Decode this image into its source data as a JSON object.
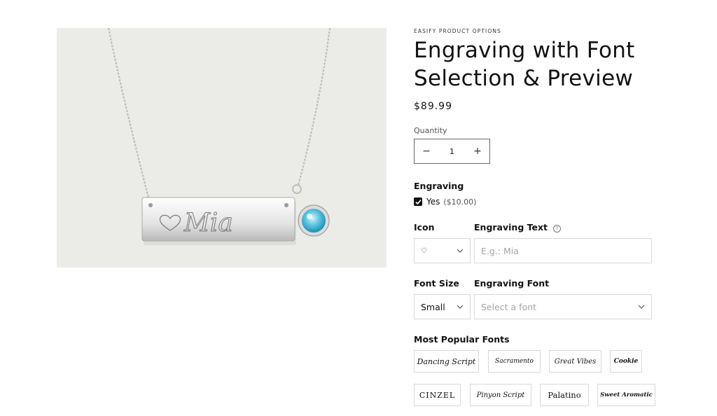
{
  "product": {
    "vendor": "EASIFY PRODUCT OPTIONS",
    "title": "Engraving with Font Selection & Preview",
    "price": "$89.99",
    "engraved_preview": "Mia"
  },
  "quantity": {
    "label": "Quantity",
    "minus": "−",
    "value": "1",
    "plus": "+"
  },
  "engraving": {
    "label": "Engraving",
    "checkbox_label": "Yes",
    "checkbox_price": "($10.00)",
    "checked": true
  },
  "icon": {
    "label": "Icon",
    "selected": "♡"
  },
  "engraving_text": {
    "label": "Engraving Text",
    "help": "?",
    "placeholder": "E.g.: Mia"
  },
  "font_size": {
    "label": "Font Size",
    "selected": "Small"
  },
  "engraving_font": {
    "label": "Engraving Font",
    "placeholder": "Select a font"
  },
  "popular_fonts": {
    "label": "Most Popular Fonts",
    "fonts": [
      "Dancing Script",
      "Sacramento",
      "Great Vibes",
      "Cookie",
      "Cinzel",
      "Pinyon Script",
      "Palatino",
      "Sweet Aromatic"
    ]
  },
  "colors": {
    "media_bg": "#ebebe8",
    "text": "#121212",
    "border": "#d8d8d8",
    "gem": "#5cc4e0"
  }
}
